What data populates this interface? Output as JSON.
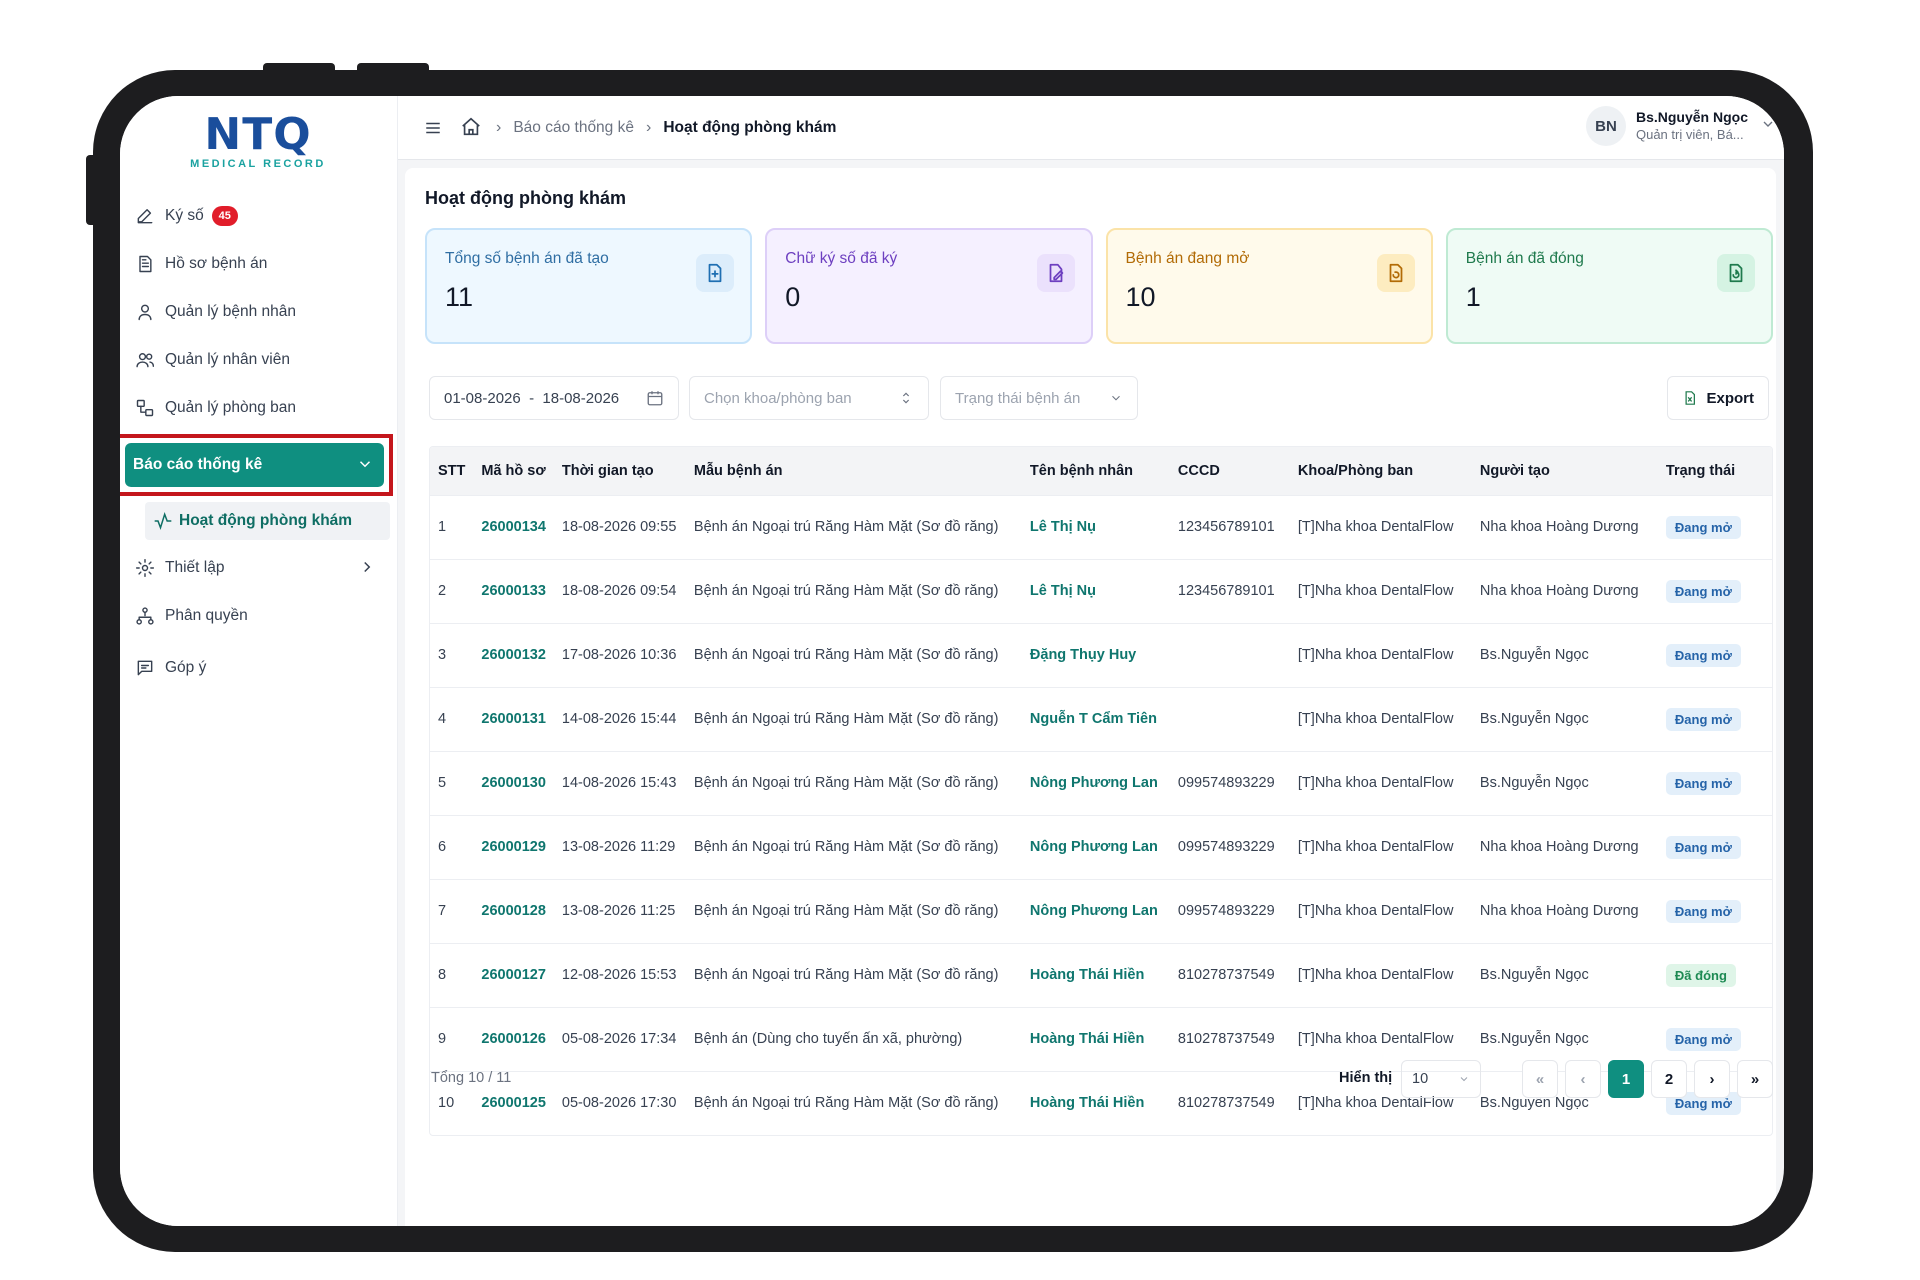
{
  "logo": {
    "main": "NTQ",
    "sub": "MEDICAL RECORD"
  },
  "sidebar": {
    "items": [
      {
        "label": "Ký số",
        "badge": "45",
        "icon": "pen-icon"
      },
      {
        "label": "Hồ sơ bệnh án",
        "icon": "document-icon"
      },
      {
        "label": "Quản lý bệnh nhân",
        "icon": "user-icon"
      },
      {
        "label": "Quản lý nhân viên",
        "icon": "users-icon"
      },
      {
        "label": "Quản lý phòng ban",
        "icon": "org-icon"
      }
    ],
    "active": {
      "label": "Báo cáo thống kê",
      "icon": "bar-chart-icon"
    },
    "sub_item": {
      "label": "Hoạt động phòng khám",
      "icon": "activity-icon"
    },
    "after": [
      {
        "label": "Thiết lập",
        "icon": "gear-icon"
      },
      {
        "label": "Phân quyền",
        "icon": "hierarchy-icon"
      },
      {
        "label": "Góp ý",
        "icon": "feedback-icon"
      }
    ]
  },
  "header": {
    "breadcrumb_parent": "Báo cáo thống kê",
    "breadcrumb_current": "Hoạt động phòng khám",
    "user_initials": "BN",
    "user_name": "Bs.Nguyễn Ngọc",
    "user_role": "Quản trị viên, Bá..."
  },
  "page_title": "Hoạt động phòng khám",
  "cards": [
    {
      "label": "Tổng số bệnh án đã tạo",
      "value": "11",
      "color": "#2f6ea3"
    },
    {
      "label": "Chữ ký số đã ký",
      "value": "0",
      "color": "#6d3fc0"
    },
    {
      "label": "Bệnh án đang mở",
      "value": "10",
      "color": "#b26b06"
    },
    {
      "label": "Bệnh án đã đóng",
      "value": "1",
      "color": "#1f7a4d"
    }
  ],
  "filters": {
    "date_range": "01-08-2026  -  18-08-2026",
    "department_placeholder": "Chọn khoa/phòng ban",
    "status_placeholder": "Trạng thái bệnh án",
    "export_label": "Export"
  },
  "table": {
    "columns": [
      "STT",
      "Mã hồ sơ",
      "Thời gian tạo",
      "Mẫu bệnh án",
      "Tên bệnh nhân",
      "CCCD",
      "Khoa/Phòng ban",
      "Người tạo",
      "Trạng thái"
    ],
    "rows": [
      {
        "stt": "1",
        "code": "26000134",
        "time": "18-08-2026 09:55",
        "template": "Bệnh án Ngoại trú Răng Hàm Mặt (Sơ đồ răng)",
        "patient": "Lê Thị Nụ",
        "cccd": "123456789101",
        "dept": "[T]Nha khoa DentalFlow",
        "creator": "Nha khoa Hoàng Dương",
        "status": "Đang mở",
        "closed": false
      },
      {
        "stt": "2",
        "code": "26000133",
        "time": "18-08-2026 09:54",
        "template": "Bệnh án Ngoại trú Răng Hàm Mặt (Sơ đồ răng)",
        "patient": "Lê Thị Nụ",
        "cccd": "123456789101",
        "dept": "[T]Nha khoa DentalFlow",
        "creator": "Nha khoa Hoàng Dương",
        "status": "Đang mở",
        "closed": false
      },
      {
        "stt": "3",
        "code": "26000132",
        "time": "17-08-2026 10:36",
        "template": "Bệnh án Ngoại trú Răng Hàm Mặt (Sơ đồ răng)",
        "patient": "Đặng Thụy Huy",
        "cccd": "",
        "dept": "[T]Nha khoa DentalFlow",
        "creator": "Bs.Nguyễn Ngọc",
        "status": "Đang mở",
        "closed": false
      },
      {
        "stt": "4",
        "code": "26000131",
        "time": "14-08-2026 15:44",
        "template": "Bệnh án Ngoại trú Răng Hàm Mặt (Sơ đồ răng)",
        "patient": "Nguễn T Cẩm Tiên",
        "cccd": "",
        "dept": "[T]Nha khoa DentalFlow",
        "creator": "Bs.Nguyễn Ngọc",
        "status": "Đang mở",
        "closed": false
      },
      {
        "stt": "5",
        "code": "26000130",
        "time": "14-08-2026 15:43",
        "template": "Bệnh án Ngoại trú Răng Hàm Mặt (Sơ đồ răng)",
        "patient": "Nông Phương Lan",
        "cccd": "099574893229",
        "dept": "[T]Nha khoa DentalFlow",
        "creator": "Bs.Nguyễn Ngọc",
        "status": "Đang mở",
        "closed": false
      },
      {
        "stt": "6",
        "code": "26000129",
        "time": "13-08-2026 11:29",
        "template": "Bệnh án Ngoại trú Răng Hàm Mặt (Sơ đồ răng)",
        "patient": "Nông Phương Lan",
        "cccd": "099574893229",
        "dept": "[T]Nha khoa DentalFlow",
        "creator": "Nha khoa Hoàng Dương",
        "status": "Đang mở",
        "closed": false
      },
      {
        "stt": "7",
        "code": "26000128",
        "time": "13-08-2026 11:25",
        "template": "Bệnh án Ngoại trú Răng Hàm Mặt (Sơ đồ răng)",
        "patient": "Nông Phương Lan",
        "cccd": "099574893229",
        "dept": "[T]Nha khoa DentalFlow",
        "creator": "Nha khoa Hoàng Dương",
        "status": "Đang mở",
        "closed": false
      },
      {
        "stt": "8",
        "code": "26000127",
        "time": "12-08-2026 15:53",
        "template": "Bệnh án Ngoại trú Răng Hàm Mặt (Sơ đồ răng)",
        "patient": "Hoàng Thái Hiền",
        "cccd": "810278737549",
        "dept": "[T]Nha khoa DentalFlow",
        "creator": "Bs.Nguyễn Ngọc",
        "status": "Đã đóng",
        "closed": true
      },
      {
        "stt": "9",
        "code": "26000126",
        "time": "05-08-2026 17:34",
        "template": "Bệnh án (Dùng cho tuyến ấn xã, phường)",
        "patient": "Hoàng Thái Hiền",
        "cccd": "810278737549",
        "dept": "[T]Nha khoa DentalFlow",
        "creator": "Bs.Nguyễn Ngọc",
        "status": "Đang mở",
        "closed": false
      },
      {
        "stt": "10",
        "code": "26000125",
        "time": "05-08-2026 17:30",
        "template": "Bệnh án Ngoại trú Răng Hàm Mặt (Sơ đồ răng)",
        "patient": "Hoàng Thái Hiền",
        "cccd": "810278737549",
        "dept": "[T]Nha khoa DentalFlow",
        "creator": "Bs.Nguyễn Ngọc",
        "status": "Đang mở",
        "closed": false
      }
    ]
  },
  "footer": {
    "total": "Tổng 10 / 11",
    "show_label": "Hiển thị",
    "page_size": "10",
    "pages": [
      "«",
      "‹",
      "1",
      "2",
      "›",
      "»"
    ],
    "current_page": "1"
  }
}
